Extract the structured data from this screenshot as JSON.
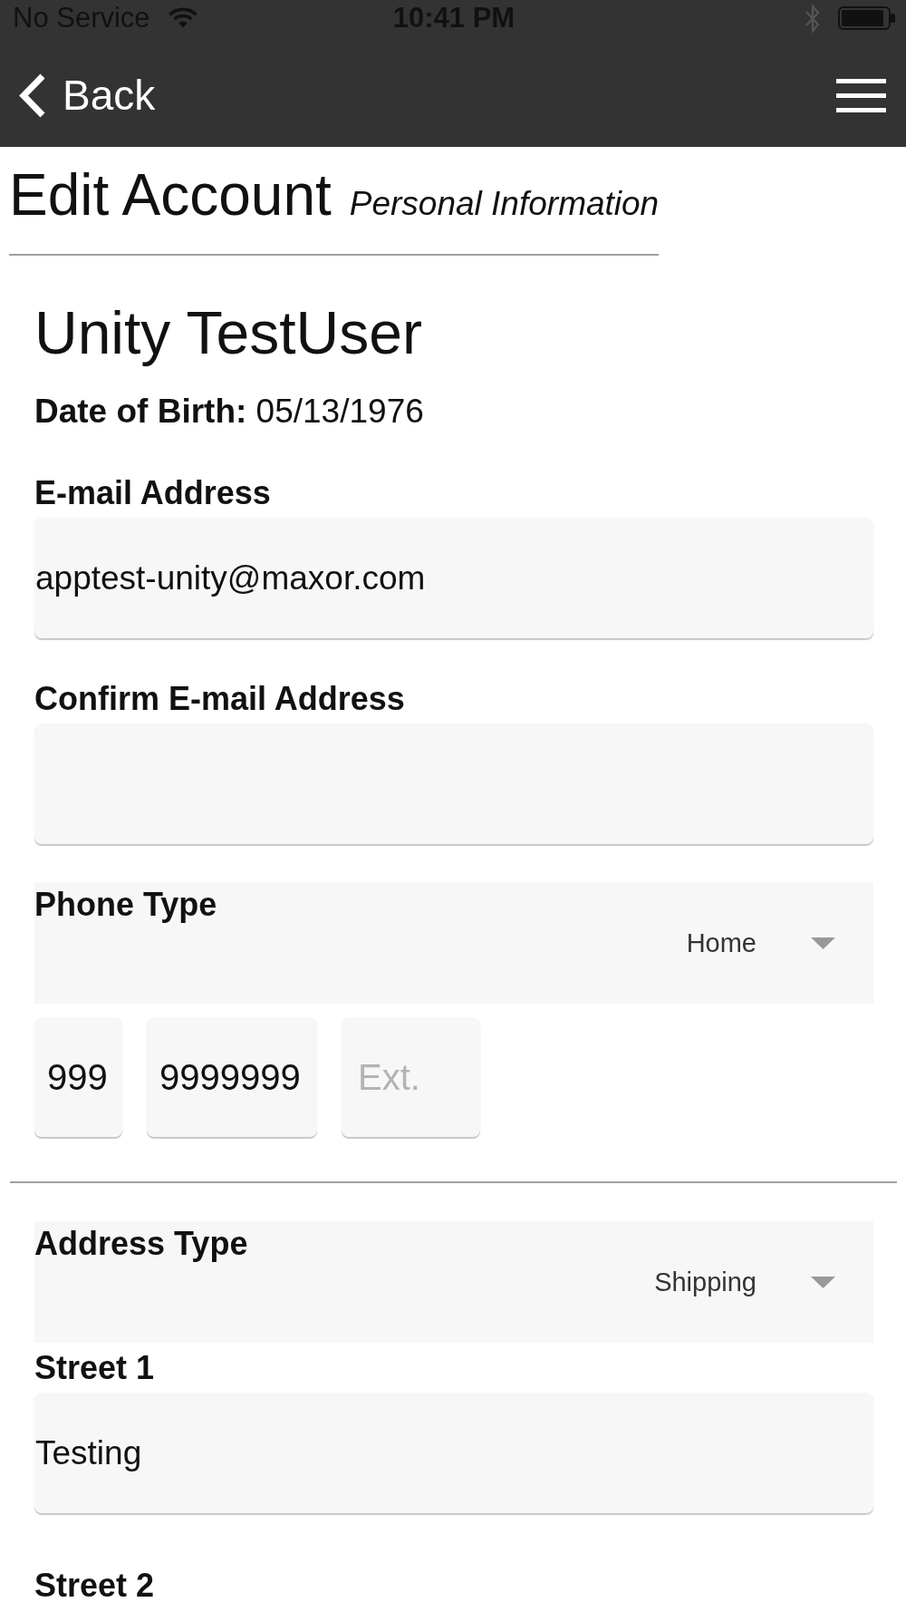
{
  "status_bar": {
    "carrier": "No Service",
    "time": "10:41 PM"
  },
  "nav_bar": {
    "back_label": "Back"
  },
  "header": {
    "title": "Edit Account",
    "subtitle": "Personal Information"
  },
  "profile": {
    "name": "Unity TestUser",
    "date_of_birth": "**Date of Birth:** 05/13/1976"
  },
  "sections": [
    {
      "fields": [
        {
          "kind": "text",
          "label": "E-mail Address",
          "value": "apptest-unity@maxor.com"
        },
        {
          "kind": "text",
          "label": "Confirm E-mail Address"
        },
        {
          "kind": "select",
          "label": "Phone Type",
          "value": "Home"
        },
        {
          "kind": "phone",
          "parts": [
            {
              "value": "999"
            },
            {
              "value": "9999999"
            },
            {
              "placeholder": "Ext."
            }
          ]
        }
      ]
    },
    {
      "fields": [
        {
          "kind": "select",
          "label": "Address Type",
          "value": "Shipping"
        },
        {
          "kind": "text",
          "label": "Street 1",
          "value": "Testing"
        },
        {
          "kind": "label",
          "label": "Street 2"
        }
      ]
    }
  ]
}
